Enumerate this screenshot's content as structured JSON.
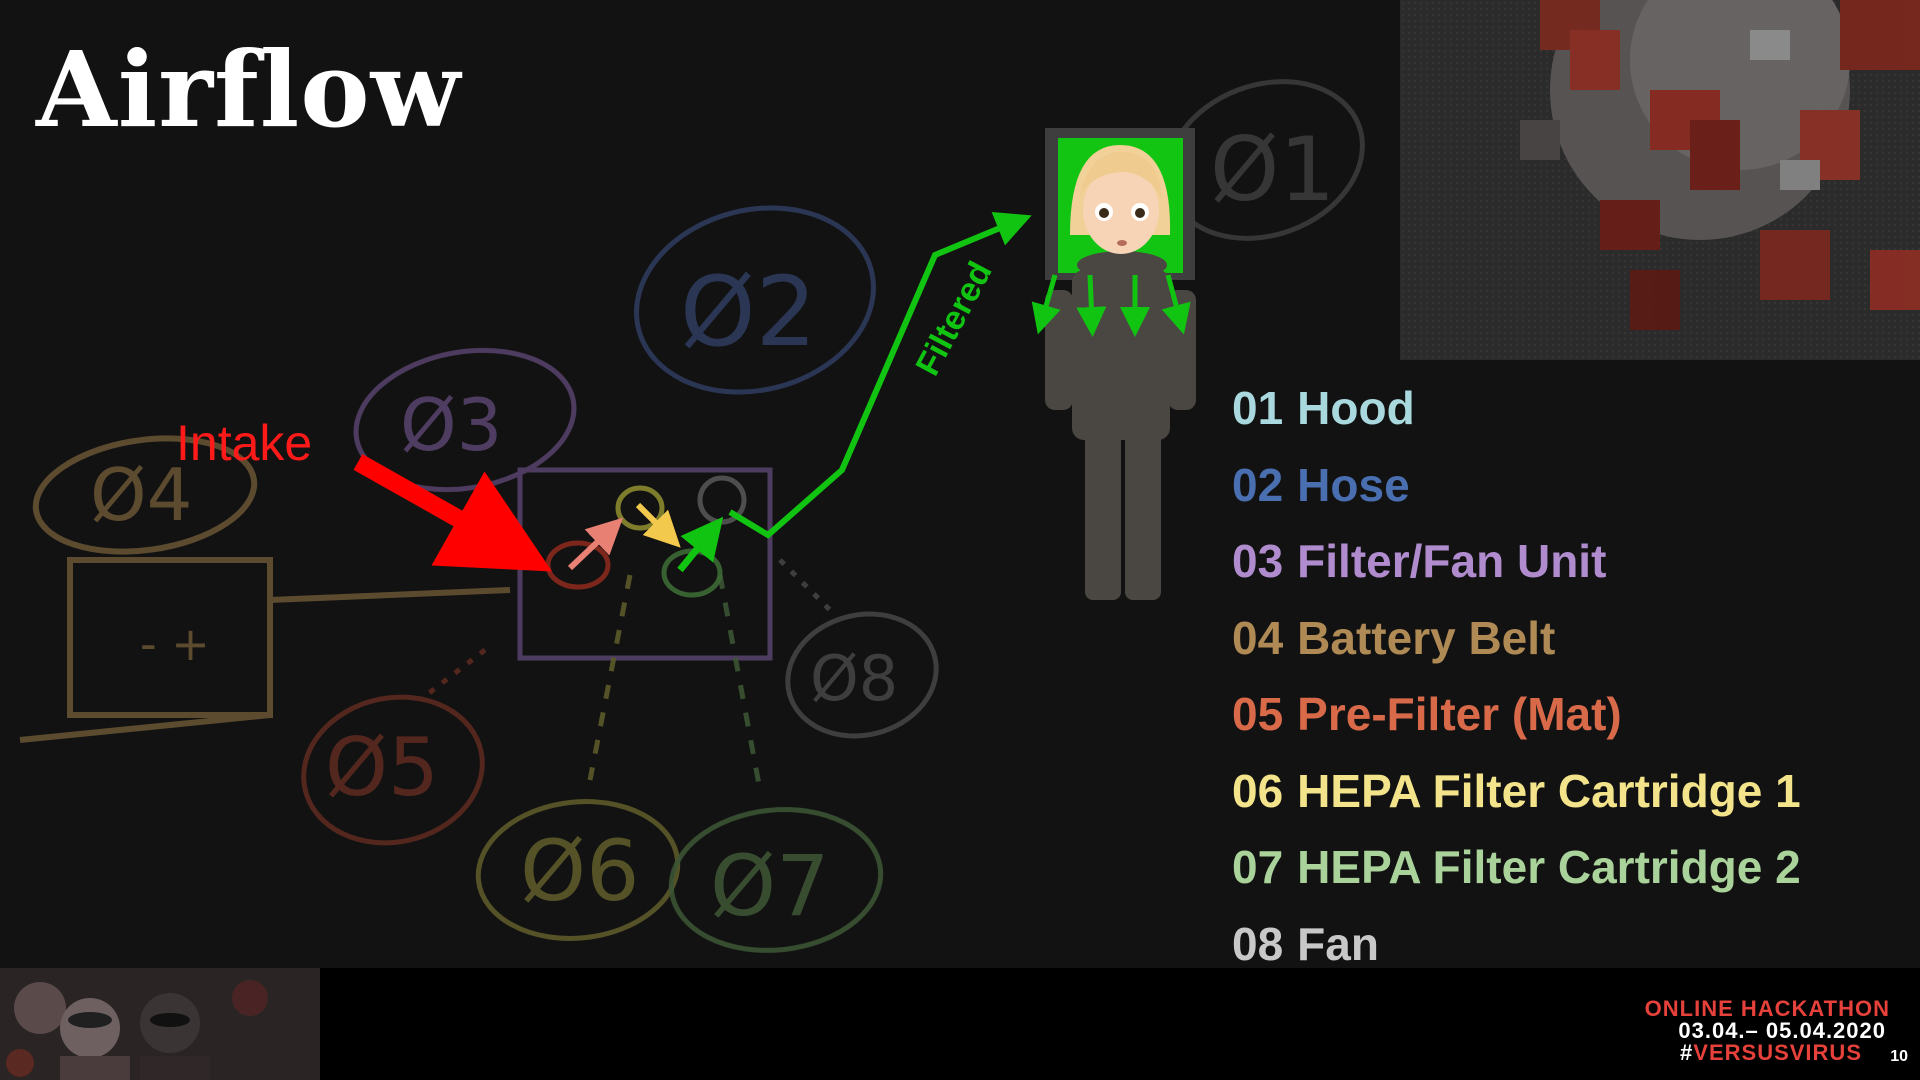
{
  "slide": {
    "title": "Airflow"
  },
  "diagram": {
    "intake_label": "Intake",
    "filtered_label": "Filtered",
    "component_markers": [
      "Ø1",
      "Ø2",
      "Ø3",
      "Ø4",
      "Ø5",
      "Ø6",
      "Ø7",
      "Ø8"
    ],
    "arrow_colors": {
      "intake": "#ff0000",
      "prefilter": "#e98074",
      "hepa1": "#f2c94c",
      "filtered": "#11c411"
    }
  },
  "legend": {
    "items": [
      {
        "number": "01",
        "label": "Hood",
        "color": "#a9d9de"
      },
      {
        "number": "02",
        "label": "Hose",
        "color": "#4a6fb0"
      },
      {
        "number": "03",
        "label": "Filter/Fan Unit",
        "color": "#b08ccf"
      },
      {
        "number": "04",
        "label": "Battery Belt",
        "color": "#b08a55"
      },
      {
        "number": "05",
        "label": "Pre-Filter (Mat)",
        "color": "#d86a4a"
      },
      {
        "number": "06",
        "label": "HEPA Filter Cartridge 1",
        "color": "#f3e38a"
      },
      {
        "number": "07",
        "label": "HEPA Filter Cartridge 2",
        "color": "#a9d39a"
      },
      {
        "number": "08",
        "label": "Fan",
        "color": "#c8c8c8"
      }
    ]
  },
  "footer": {
    "event_title": "ONLINE HACKATHON",
    "event_dates": "03.04.– 05.04.2020",
    "event_hashtag_prefix": "#",
    "event_hashtag": "VERSUSVIRUS",
    "page_number": "10"
  }
}
